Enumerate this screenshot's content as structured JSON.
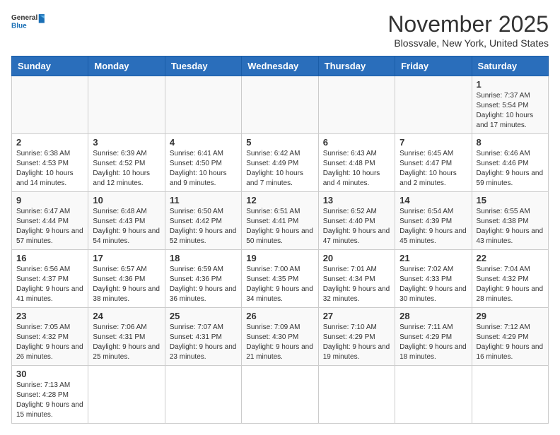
{
  "header": {
    "logo_line1": "General",
    "logo_line2": "Blue",
    "month_title": "November 2025",
    "subtitle": "Blossvale, New York, United States"
  },
  "days_of_week": [
    "Sunday",
    "Monday",
    "Tuesday",
    "Wednesday",
    "Thursday",
    "Friday",
    "Saturday"
  ],
  "weeks": [
    {
      "days": [
        {
          "number": "",
          "info": ""
        },
        {
          "number": "",
          "info": ""
        },
        {
          "number": "",
          "info": ""
        },
        {
          "number": "",
          "info": ""
        },
        {
          "number": "",
          "info": ""
        },
        {
          "number": "",
          "info": ""
        },
        {
          "number": "1",
          "info": "Sunrise: 7:37 AM\nSunset: 5:54 PM\nDaylight: 10 hours and 17 minutes."
        }
      ]
    },
    {
      "days": [
        {
          "number": "2",
          "info": "Sunrise: 6:38 AM\nSunset: 4:53 PM\nDaylight: 10 hours and 14 minutes."
        },
        {
          "number": "3",
          "info": "Sunrise: 6:39 AM\nSunset: 4:52 PM\nDaylight: 10 hours and 12 minutes."
        },
        {
          "number": "4",
          "info": "Sunrise: 6:41 AM\nSunset: 4:50 PM\nDaylight: 10 hours and 9 minutes."
        },
        {
          "number": "5",
          "info": "Sunrise: 6:42 AM\nSunset: 4:49 PM\nDaylight: 10 hours and 7 minutes."
        },
        {
          "number": "6",
          "info": "Sunrise: 6:43 AM\nSunset: 4:48 PM\nDaylight: 10 hours and 4 minutes."
        },
        {
          "number": "7",
          "info": "Sunrise: 6:45 AM\nSunset: 4:47 PM\nDaylight: 10 hours and 2 minutes."
        },
        {
          "number": "8",
          "info": "Sunrise: 6:46 AM\nSunset: 4:46 PM\nDaylight: 9 hours and 59 minutes."
        }
      ]
    },
    {
      "days": [
        {
          "number": "9",
          "info": "Sunrise: 6:47 AM\nSunset: 4:44 PM\nDaylight: 9 hours and 57 minutes."
        },
        {
          "number": "10",
          "info": "Sunrise: 6:48 AM\nSunset: 4:43 PM\nDaylight: 9 hours and 54 minutes."
        },
        {
          "number": "11",
          "info": "Sunrise: 6:50 AM\nSunset: 4:42 PM\nDaylight: 9 hours and 52 minutes."
        },
        {
          "number": "12",
          "info": "Sunrise: 6:51 AM\nSunset: 4:41 PM\nDaylight: 9 hours and 50 minutes."
        },
        {
          "number": "13",
          "info": "Sunrise: 6:52 AM\nSunset: 4:40 PM\nDaylight: 9 hours and 47 minutes."
        },
        {
          "number": "14",
          "info": "Sunrise: 6:54 AM\nSunset: 4:39 PM\nDaylight: 9 hours and 45 minutes."
        },
        {
          "number": "15",
          "info": "Sunrise: 6:55 AM\nSunset: 4:38 PM\nDaylight: 9 hours and 43 minutes."
        }
      ]
    },
    {
      "days": [
        {
          "number": "16",
          "info": "Sunrise: 6:56 AM\nSunset: 4:37 PM\nDaylight: 9 hours and 41 minutes."
        },
        {
          "number": "17",
          "info": "Sunrise: 6:57 AM\nSunset: 4:36 PM\nDaylight: 9 hours and 38 minutes."
        },
        {
          "number": "18",
          "info": "Sunrise: 6:59 AM\nSunset: 4:36 PM\nDaylight: 9 hours and 36 minutes."
        },
        {
          "number": "19",
          "info": "Sunrise: 7:00 AM\nSunset: 4:35 PM\nDaylight: 9 hours and 34 minutes."
        },
        {
          "number": "20",
          "info": "Sunrise: 7:01 AM\nSunset: 4:34 PM\nDaylight: 9 hours and 32 minutes."
        },
        {
          "number": "21",
          "info": "Sunrise: 7:02 AM\nSunset: 4:33 PM\nDaylight: 9 hours and 30 minutes."
        },
        {
          "number": "22",
          "info": "Sunrise: 7:04 AM\nSunset: 4:32 PM\nDaylight: 9 hours and 28 minutes."
        }
      ]
    },
    {
      "days": [
        {
          "number": "23",
          "info": "Sunrise: 7:05 AM\nSunset: 4:32 PM\nDaylight: 9 hours and 26 minutes."
        },
        {
          "number": "24",
          "info": "Sunrise: 7:06 AM\nSunset: 4:31 PM\nDaylight: 9 hours and 25 minutes."
        },
        {
          "number": "25",
          "info": "Sunrise: 7:07 AM\nSunset: 4:31 PM\nDaylight: 9 hours and 23 minutes."
        },
        {
          "number": "26",
          "info": "Sunrise: 7:09 AM\nSunset: 4:30 PM\nDaylight: 9 hours and 21 minutes."
        },
        {
          "number": "27",
          "info": "Sunrise: 7:10 AM\nSunset: 4:29 PM\nDaylight: 9 hours and 19 minutes."
        },
        {
          "number": "28",
          "info": "Sunrise: 7:11 AM\nSunset: 4:29 PM\nDaylight: 9 hours and 18 minutes."
        },
        {
          "number": "29",
          "info": "Sunrise: 7:12 AM\nSunset: 4:29 PM\nDaylight: 9 hours and 16 minutes."
        }
      ]
    },
    {
      "days": [
        {
          "number": "30",
          "info": "Sunrise: 7:13 AM\nSunset: 4:28 PM\nDaylight: 9 hours and 15 minutes."
        },
        {
          "number": "",
          "info": ""
        },
        {
          "number": "",
          "info": ""
        },
        {
          "number": "",
          "info": ""
        },
        {
          "number": "",
          "info": ""
        },
        {
          "number": "",
          "info": ""
        },
        {
          "number": "",
          "info": ""
        }
      ]
    }
  ]
}
